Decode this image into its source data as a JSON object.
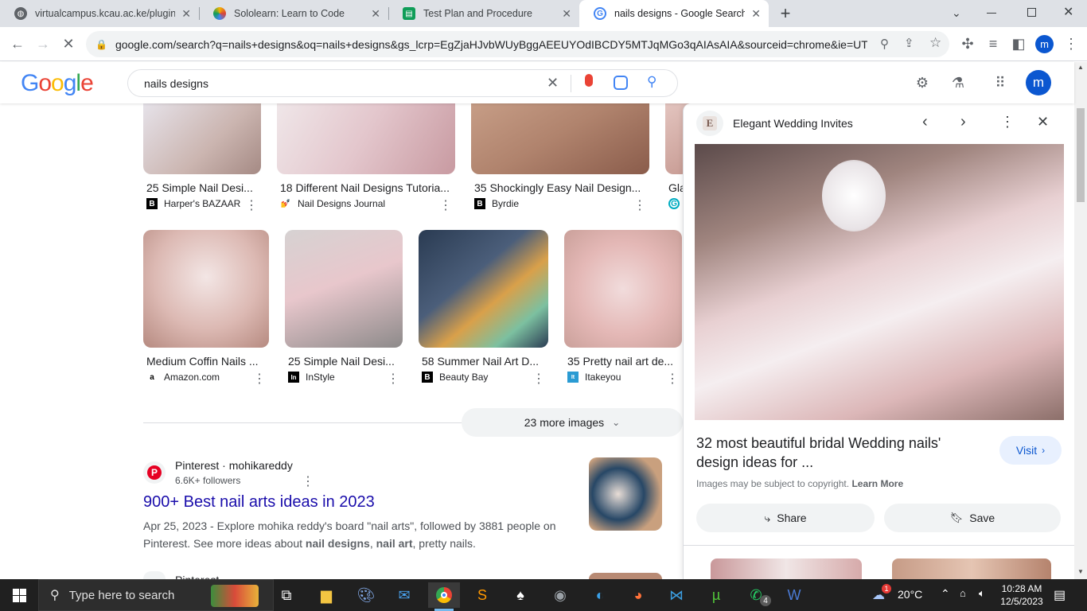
{
  "browser": {
    "tabs": [
      {
        "title": "virtualcampus.kcau.ac.ke/plugin",
        "close": "✕",
        "icon": "globe-icon"
      },
      {
        "title": "Sololearn: Learn to Code",
        "close": "✕",
        "icon": "sololearn-icon"
      },
      {
        "title": "Test Plan and Procedure",
        "close": "✕",
        "icon": "document-icon"
      },
      {
        "title": "nails designs - Google Search",
        "close": "✕",
        "icon": "google-icon"
      }
    ],
    "new_tab": "+",
    "url": "google.com/search?q=nails+designs&oq=nails+designs&gs_lcrp=EgZjaHJvbWUyBggAEEUYOdIBCDY5MTJqMGo3qAIAsAIA&sourceid=chrome&ie=UTF...",
    "profile_initial": "m"
  },
  "google": {
    "logo": "Google",
    "query": "nails designs",
    "avatar_initial": "m"
  },
  "results": {
    "row1": [
      {
        "title": "25 Simple Nail Desi...",
        "source": "Harper's BAZAAR",
        "src_icon": "B"
      },
      {
        "title": "18 Different Nail Designs Tutoria...",
        "source": "Nail Designs Journal",
        "src_icon": "💅"
      },
      {
        "title": "35 Shockingly Easy Nail Design...",
        "source": "Byrdie",
        "src_icon": "B"
      },
      {
        "title": "Gla",
        "source": "",
        "src_icon": "G"
      }
    ],
    "row2": [
      {
        "title": "Medium Coffin Nails ...",
        "source": "Amazon.com",
        "src_icon": "a"
      },
      {
        "title": "25 Simple Nail Desi...",
        "source": "InStyle",
        "src_icon": "In"
      },
      {
        "title": "58 Summer Nail Art D...",
        "source": "Beauty Bay",
        "src_icon": "B"
      },
      {
        "title": "35 Pretty nail art de...",
        "source": "Itakeyou",
        "src_icon": "It"
      }
    ],
    "more_images": "23 more images",
    "pinterest": {
      "site": "Pinterest · mohikareddy",
      "followers": "6.6K+ followers",
      "title": "900+ Best nail arts ideas in 2023",
      "snippet_date": "Apr 25, 2023 - Explore mohika reddy's board \"nail arts\", followed by 3881 people on Pinterest. See more ideas about ",
      "snippet_b1": "nail designs",
      "snippet_sep": ", ",
      "snippet_b2": "nail art",
      "snippet_end": ", pretty nails."
    },
    "next_site": "Pinterest"
  },
  "panel": {
    "site_initial": "E",
    "site_name": "Elegant Wedding Invites",
    "title": "32 most beautiful bridal Wedding nails' design ideas for ...",
    "visit": "Visit",
    "copyright": "Images may be subject to copyright.",
    "learn_more": "Learn More",
    "share": "Share",
    "save": "Save"
  },
  "taskbar": {
    "search_placeholder": "Type here to search",
    "temperature": "20°C",
    "time": "10:28 AM",
    "date": "12/5/2023",
    "whatsapp_badge": "4",
    "weather_badge": "1"
  },
  "colors": {
    "link": "#1a0dab",
    "accent_blue": "#1a73e8",
    "profile": "#0b57d0",
    "taskbar": "#202020"
  }
}
